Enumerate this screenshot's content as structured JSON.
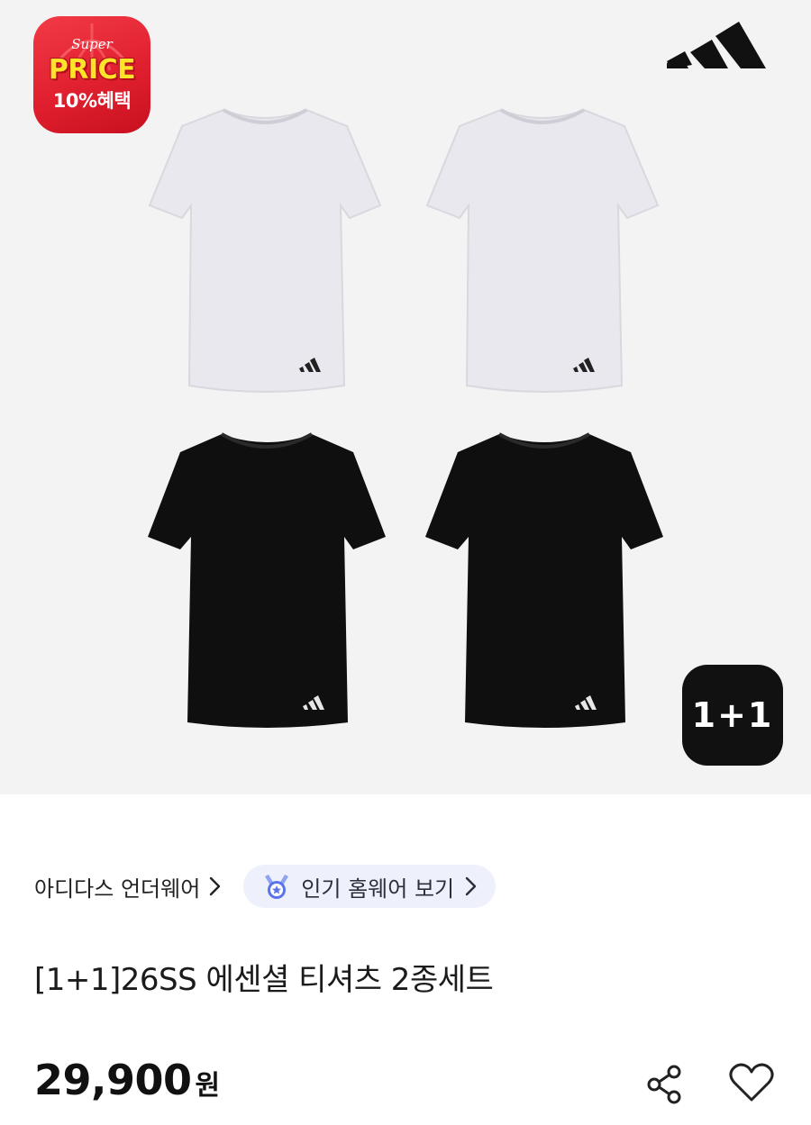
{
  "promo": {
    "line1": "Super",
    "line2": "PRICE",
    "line3": "10%혜택",
    "colors": {
      "background": "#e1202f",
      "price_text": "#ffe22a"
    }
  },
  "brand_logo_icon": "adidas-logo-icon",
  "gallery": {
    "items": [
      {
        "color": "white",
        "icon": "tshirt-white-icon"
      },
      {
        "color": "white",
        "icon": "tshirt-white-icon"
      },
      {
        "color": "black",
        "icon": "tshirt-black-icon"
      },
      {
        "color": "black",
        "icon": "tshirt-black-icon"
      }
    ],
    "bundle_badge": "1+1"
  },
  "brand_link": {
    "label": "아디다스 언더웨어",
    "icon": "chevron-right-icon"
  },
  "popular_chip": {
    "label": "인기 홈웨어 보기",
    "icon": "medal-icon",
    "bg": "#eef1fb"
  },
  "product": {
    "title": "[1+1]26SS 에센셜 티셔츠 2종세트",
    "price": "29,900",
    "currency": "원"
  },
  "actions": {
    "share_icon": "share-icon",
    "like_icon": "heart-icon"
  }
}
